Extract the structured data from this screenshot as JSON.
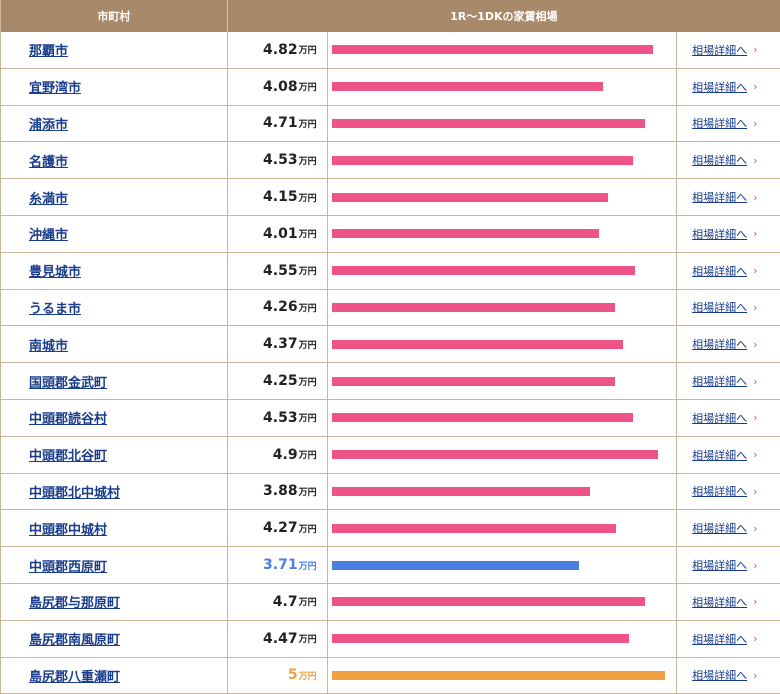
{
  "header": {
    "city_label": "市町村",
    "rent_label": "1R〜1DKの家賃相場"
  },
  "unit": "万円",
  "link_label": "相場詳細へ",
  "link_chevron": "›",
  "scale_max": 5.0,
  "colors": {
    "default": "#ee5486",
    "min": "#4a7fe0",
    "max": "#f0a040"
  },
  "rows": [
    {
      "city": "那覇市",
      "value": "4.82",
      "v": 4.82,
      "kind": "default"
    },
    {
      "city": "宜野湾市",
      "value": "4.08",
      "v": 4.08,
      "kind": "default"
    },
    {
      "city": "浦添市",
      "value": "4.71",
      "v": 4.71,
      "kind": "default"
    },
    {
      "city": "名護市",
      "value": "4.53",
      "v": 4.53,
      "kind": "default"
    },
    {
      "city": "糸満市",
      "value": "4.15",
      "v": 4.15,
      "kind": "default"
    },
    {
      "city": "沖縄市",
      "value": "4.01",
      "v": 4.01,
      "kind": "default"
    },
    {
      "city": "豊見城市",
      "value": "4.55",
      "v": 4.55,
      "kind": "default"
    },
    {
      "city": "うるま市",
      "value": "4.26",
      "v": 4.26,
      "kind": "default"
    },
    {
      "city": "南城市",
      "value": "4.37",
      "v": 4.37,
      "kind": "default"
    },
    {
      "city": "国頭郡金武町",
      "value": "4.25",
      "v": 4.25,
      "kind": "default"
    },
    {
      "city": "中頭郡読谷村",
      "value": "4.53",
      "v": 4.53,
      "kind": "default"
    },
    {
      "city": "中頭郡北谷町",
      "value": "4.9",
      "v": 4.9,
      "kind": "default"
    },
    {
      "city": "中頭郡北中城村",
      "value": "3.88",
      "v": 3.88,
      "kind": "default"
    },
    {
      "city": "中頭郡中城村",
      "value": "4.27",
      "v": 4.27,
      "kind": "default"
    },
    {
      "city": "中頭郡西原町",
      "value": "3.71",
      "v": 3.71,
      "kind": "min"
    },
    {
      "city": "島尻郡与那原町",
      "value": "4.7",
      "v": 4.7,
      "kind": "default"
    },
    {
      "city": "島尻郡南風原町",
      "value": "4.47",
      "v": 4.47,
      "kind": "default"
    },
    {
      "city": "島尻郡八重瀬町",
      "value": "5",
      "v": 5.0,
      "kind": "max"
    }
  ]
}
